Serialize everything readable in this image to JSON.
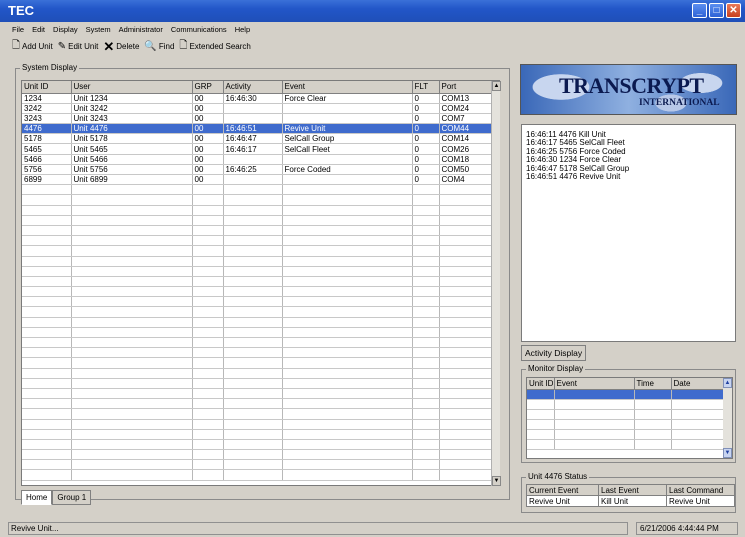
{
  "window": {
    "title": "TEC",
    "min": "_",
    "max": "□",
    "close": "✕"
  },
  "menu": [
    "File",
    "Edit",
    "Display",
    "System",
    "Administrator",
    "Communications",
    "Help"
  ],
  "toolbar": {
    "add_unit": "Add Unit",
    "edit_unit": "Edit Unit",
    "delete": "Delete",
    "find": "Find",
    "extended_search": "Extended Search"
  },
  "system_display": {
    "label": "System Display",
    "columns": [
      "Unit ID",
      "User",
      "GRP",
      "Activity",
      "Event",
      "FLT",
      "Port"
    ],
    "rows": [
      [
        "1234",
        "Unit 1234",
        "00",
        "16:46:30",
        "Force Clear",
        "0",
        "COM13"
      ],
      [
        "3242",
        "Unit 3242",
        "00",
        "",
        "",
        "0",
        "COM24"
      ],
      [
        "3243",
        "Unit 3243",
        "00",
        "",
        "",
        "0",
        "COM7"
      ],
      [
        "4476",
        "Unit 4476",
        "00",
        "16:46:51",
        "Revive Unit",
        "0",
        "COM44"
      ],
      [
        "5178",
        "Unit 5178",
        "00",
        "16:46:47",
        "SelCall Group",
        "0",
        "COM14"
      ],
      [
        "5465",
        "Unit 5465",
        "00",
        "16:46:17",
        "SelCall Fleet",
        "0",
        "COM26"
      ],
      [
        "5466",
        "Unit 5466",
        "00",
        "",
        "",
        "0",
        "COM18"
      ],
      [
        "5756",
        "Unit 5756",
        "00",
        "16:46:25",
        "Force Coded",
        "0",
        "COM50"
      ],
      [
        "6899",
        "Unit 6899",
        "00",
        "",
        "",
        "0",
        "COM4"
      ]
    ],
    "selected_index": 3,
    "tabs": [
      "Home",
      "Group 1"
    ]
  },
  "logo": {
    "name": "TRANSCRYPT",
    "sub": "INTERNATIONAL"
  },
  "activity_log": [
    "16:46:11  4476 Kill Unit",
    "16:46:17  5465 SelCall Fleet",
    "16:46:25  5756 Force Coded",
    "16:46:30  1234 Force Clear",
    "16:46:47  5178 SelCall Group",
    "16:46:51  4476 Revive Unit"
  ],
  "activity_tab": "Activity Display",
  "monitor": {
    "label": "Monitor Display",
    "columns": [
      "Unit ID",
      "Event",
      "Time",
      "Date"
    ]
  },
  "unit_status": {
    "label": "Unit 4476 Status",
    "headers": [
      "Current Event",
      "Last Event",
      "Last Command"
    ],
    "values": [
      "Revive Unit",
      "Kill Unit",
      "Revive Unit"
    ]
  },
  "statusbar": {
    "message": "Revive Unit...",
    "datetime": "6/21/2006  4:44:44 PM"
  }
}
